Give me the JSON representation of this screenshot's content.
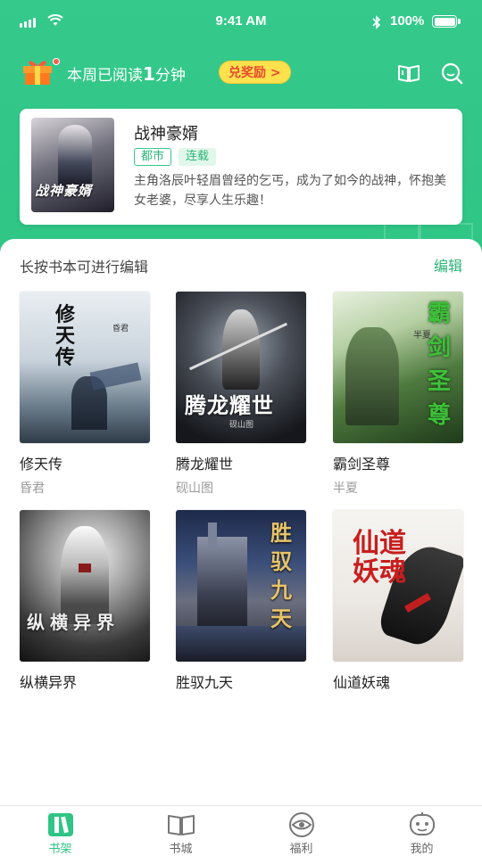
{
  "status_bar": {
    "time": "9:41 AM",
    "battery": "100%"
  },
  "header": {
    "reading_prefix": "本周已阅读",
    "reading_number": "1",
    "reading_unit": "分钟",
    "redeem_label": "兑奖励 >"
  },
  "featured": {
    "title": "战神豪婿",
    "tags": [
      "都市",
      "连载"
    ],
    "description": "主角洛辰叶轻眉曾经的乞丐，成为了如今的战神，怀抱美女老婆，尽享人生乐趣！",
    "cover_text": "战神豪婿"
  },
  "shelf": {
    "hint": "长按书本可进行编辑",
    "edit_label": "编辑",
    "books": [
      {
        "title": "修天传",
        "author": "昏君",
        "cover_text": "修天传"
      },
      {
        "title": "腾龙耀世",
        "author": "砚山图",
        "cover_text": "腾龙耀世"
      },
      {
        "title": "霸剑圣尊",
        "author": "半夏",
        "cover_text": "霸剑圣尊"
      },
      {
        "title": "纵横异界",
        "author": "",
        "cover_text": "纵横异界"
      },
      {
        "title": "胜驭九天",
        "author": "",
        "cover_text": "胜驭九天"
      },
      {
        "title": "仙道妖魂",
        "author": "",
        "cover_text": "仙道妖魂"
      }
    ]
  },
  "tabs": [
    {
      "label": "书架",
      "icon": "bookshelf-icon",
      "active": true
    },
    {
      "label": "书城",
      "icon": "open-book-icon",
      "active": false
    },
    {
      "label": "福利",
      "icon": "eye-coin-icon",
      "active": false
    },
    {
      "label": "我的",
      "icon": "robot-face-icon",
      "active": false
    }
  ],
  "colors": {
    "brand": "#35c98b",
    "accent_yellow": "#ffe14d",
    "accent_red": "#e8492d"
  }
}
